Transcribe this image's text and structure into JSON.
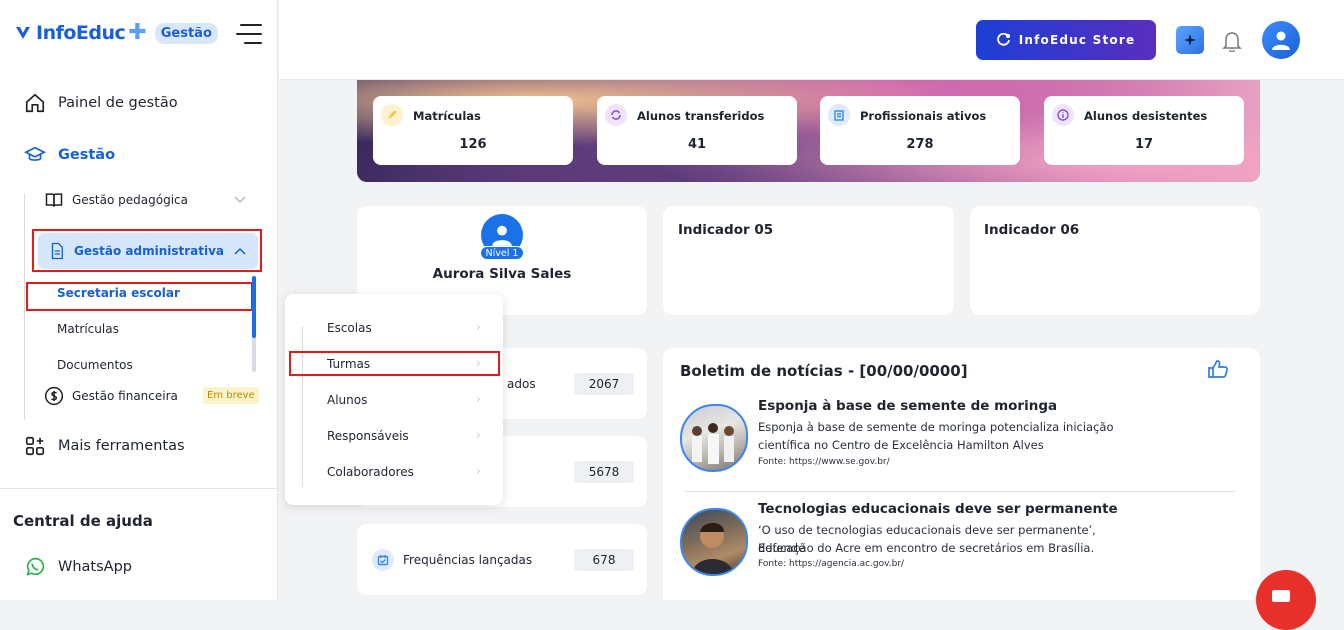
{
  "sidebar": {
    "logo_text": "InfoEduc",
    "logo_badge": "Gestão",
    "nav": {
      "painel": "Painel de gestão",
      "gestao": "Gestão",
      "gestao_pedagogica": "Gestão pedagógica",
      "gestao_administrativa": "Gestão administrativa",
      "secretaria": "Secretaria escolar",
      "matriculas": "Matrículas",
      "documentos": "Documentos",
      "gestao_financeira": "Gestão financeira",
      "em_breve": "Em breve",
      "mais_ferramentas": "Mais ferramentas"
    },
    "help_title": "Central de ajuda",
    "whatsapp": "WhatsApp"
  },
  "topbar": {
    "store_label": "InfoEduc Store"
  },
  "stats": [
    {
      "label": "Matrículas",
      "value": "126",
      "color": "#f5c542"
    },
    {
      "label": "Alunos transferidos",
      "value": "41",
      "color": "#8a4fd8"
    },
    {
      "label": "Profissionais ativos",
      "value": "278",
      "color": "#3b86f0"
    },
    {
      "label": "Alunos desistentes",
      "value": "17",
      "color": "#8a4fd8"
    }
  ],
  "profile": {
    "level": "Nível 1",
    "name": "Aurora Silva Sales"
  },
  "indicators": {
    "ind5": "Indicador 05",
    "ind6": "Indicador 06"
  },
  "rows": [
    {
      "label": "ados",
      "value": "2067"
    },
    {
      "label": "",
      "value": "5678"
    },
    {
      "label": "Frequências lançadas",
      "value": "678"
    }
  ],
  "news": {
    "title": "Boletim de notícias - [00/00/0000]",
    "items": [
      {
        "headline": "Esponja à base de semente de moringa",
        "text1": "Esponja à base de semente de moringa potencializa iniciação",
        "text2": "científica no Centro de Excelência Hamilton Alves",
        "source": "Fonte: https://www.se.gov.br/"
      },
      {
        "headline": "Tecnologias educacionais deve ser permanente",
        "text1": "‘O uso de tecnologias educacionais deve ser permanente’, defende",
        "text2": "Educação do Acre em encontro de secretários em Brasília.",
        "source": "Fonte: https://agencia.ac.gov.br/"
      }
    ]
  },
  "menu": [
    "Escolas",
    "Turmas",
    "Alunos",
    "Responsáveis",
    "Colaboradores"
  ],
  "colors": {
    "accent": "#1b72e8",
    "highlight": "#e21b1b"
  }
}
